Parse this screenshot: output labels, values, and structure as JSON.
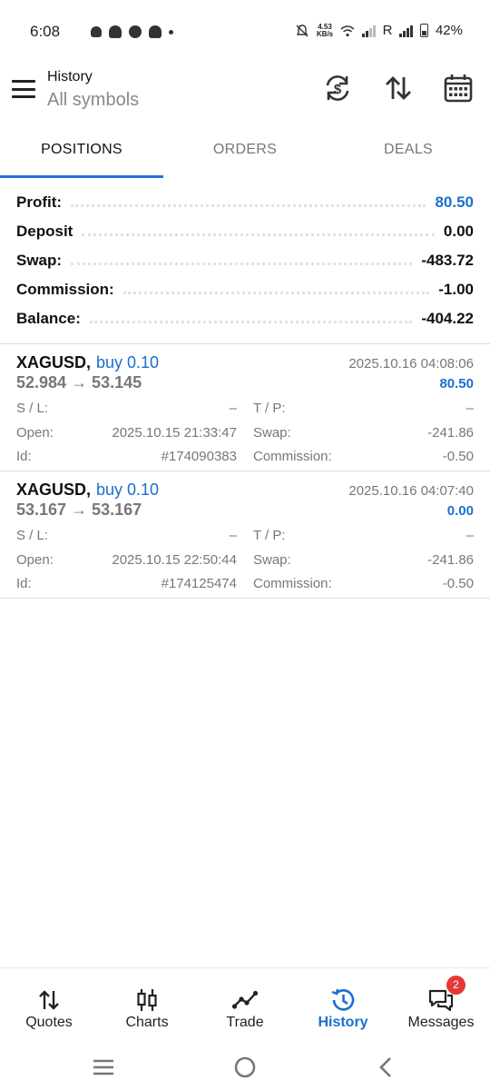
{
  "status_bar": {
    "time": "6:08",
    "net_speed_value": "4.53",
    "net_speed_unit": "KB/s",
    "roaming": "R",
    "battery": "42%"
  },
  "header": {
    "title": "History",
    "subtitle": "All symbols"
  },
  "tabs": [
    {
      "label": "POSITIONS",
      "active": true
    },
    {
      "label": "ORDERS",
      "active": false
    },
    {
      "label": "DEALS",
      "active": false
    }
  ],
  "summary": {
    "profit": {
      "label": "Profit:",
      "value": "80.50"
    },
    "deposit": {
      "label": "Deposit",
      "value": "0.00"
    },
    "swap": {
      "label": "Swap:",
      "value": "-483.72"
    },
    "commission": {
      "label": "Commission:",
      "value": "-1.00"
    },
    "balance": {
      "label": "Balance:",
      "value": "-404.22"
    }
  },
  "positions": [
    {
      "symbol": "XAGUSD,",
      "direction": "buy 0.10",
      "prices": "52.984 → 53.145",
      "close_time": "2025.10.16 04:08:06",
      "profit": "80.50",
      "sl_label": "S / L:",
      "sl_value": "–",
      "tp_label": "T / P:",
      "tp_value": "–",
      "open_label": "Open:",
      "open_value": "2025.10.15 21:33:47",
      "swap_label": "Swap:",
      "swap_value": "-241.86",
      "id_label": "Id:",
      "id_value": "#174090383",
      "commission_label": "Commission:",
      "commission_value": "-0.50"
    },
    {
      "symbol": "XAGUSD,",
      "direction": "buy 0.10",
      "prices": "53.167 → 53.167",
      "close_time": "2025.10.16 04:07:40",
      "profit": "0.00",
      "sl_label": "S / L:",
      "sl_value": "–",
      "tp_label": "T / P:",
      "tp_value": "–",
      "open_label": "Open:",
      "open_value": "2025.10.15 22:50:44",
      "swap_label": "Swap:",
      "swap_value": "-241.86",
      "id_label": "Id:",
      "id_value": "#174125474",
      "commission_label": "Commission:",
      "commission_value": "-0.50"
    }
  ],
  "bottom_nav": [
    {
      "label": "Quotes",
      "icon": "quotes-arrows-icon",
      "active": false
    },
    {
      "label": "Charts",
      "icon": "candlestick-icon",
      "active": false
    },
    {
      "label": "Trade",
      "icon": "trend-line-icon",
      "active": false
    },
    {
      "label": "History",
      "icon": "history-clock-icon",
      "active": true
    },
    {
      "label": "Messages",
      "icon": "chat-bubbles-icon",
      "active": false,
      "badge": "2"
    }
  ],
  "colors": {
    "accent": "#1a6fd0",
    "tab_indicator": "#2473d8",
    "badge": "#e53935"
  }
}
